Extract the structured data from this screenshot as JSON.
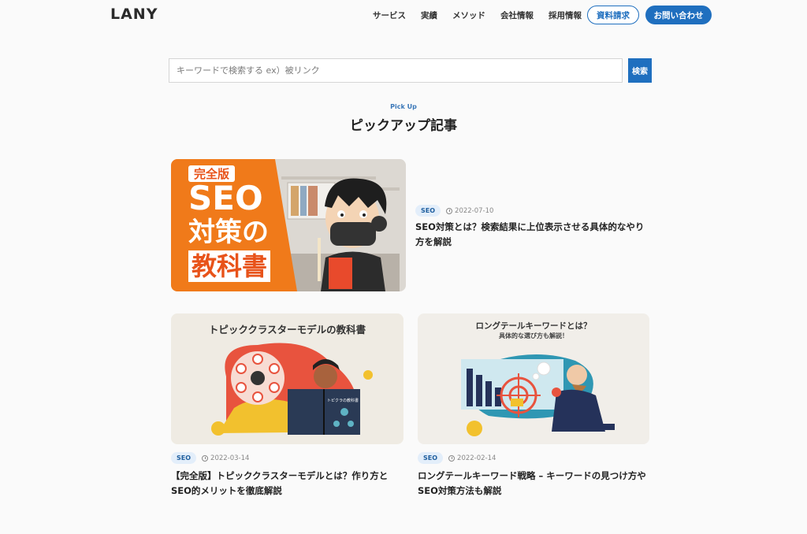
{
  "header": {
    "logo": "LANY",
    "nav": [
      "サービス",
      "実績",
      "メソッド",
      "会社情報",
      "採用情報"
    ],
    "doc_button": "資料請求",
    "contact_button": "お問い合わせ"
  },
  "search": {
    "placeholder": "キーワードで検索する ex）被リンク",
    "button": "検索"
  },
  "section": {
    "eyebrow": "Pick Up",
    "title": "ピックアップ記事"
  },
  "articles": [
    {
      "thumb_text": [
        "完全版",
        "SEO",
        "対策の",
        "教科書"
      ],
      "tag": "SEO",
      "date": "2022-07-10",
      "title": "SEO対策とは？検索結果に上位表示させる具体的なやり方を解説"
    },
    {
      "thumb_text": [
        "トピッククラスターモデルの教科書",
        "トピクラの教科書"
      ],
      "tag": "SEO",
      "date": "2022-03-14",
      "title": "【完全版】トピッククラスターモデルとは？作り方とSEO的メリットを徹底解説"
    },
    {
      "thumb_text": [
        "ロングテールキーワードとは？",
        "具体的な選び方も解説！"
      ],
      "tag": "SEO",
      "date": "2022-02-14",
      "title": "ロングテールキーワード戦略 – キーワードの見つけ方やSEO対策方法も解説"
    }
  ],
  "colors": {
    "accent": "#1f6fbf",
    "orange": "#f07a1a",
    "red": "#e8533e",
    "yellow": "#f2c12e",
    "teal": "#5fb3c4"
  }
}
